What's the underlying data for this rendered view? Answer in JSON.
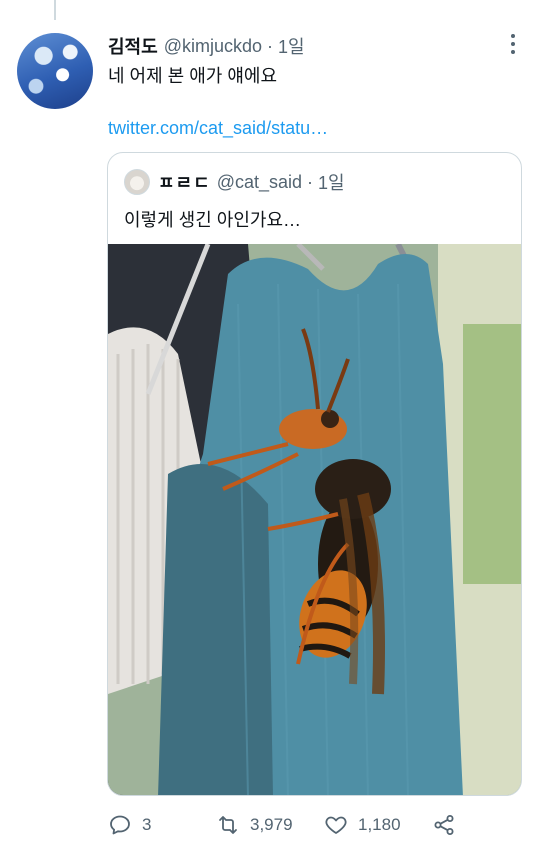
{
  "tweet": {
    "author": {
      "name": "김적도",
      "handle": "@kimjuckdo",
      "separator": "·",
      "time": "1일"
    },
    "text": "네 어제 본 애가 얘에요",
    "link": "twitter.com/cat_said/statu…",
    "quoted": {
      "author": {
        "name": "ㅍㄹㄷ",
        "handle": "@cat_said",
        "separator": "·",
        "time": "1일"
      },
      "text": "이렇게 생긴 아인가요…",
      "media_alt": "photo of a large hornet on a teal sweater hanging on a clothes hanger"
    },
    "actions": {
      "reply_count": "3",
      "retweet_count": "3,979",
      "like_count": "1,180"
    }
  },
  "icons": {
    "more": "more-dots-icon",
    "reply": "reply-icon",
    "retweet": "retweet-icon",
    "like": "heart-icon",
    "share": "share-icon"
  },
  "colors": {
    "link": "#1d9bf0",
    "secondary_text": "#536471",
    "border": "#cfd9de"
  }
}
